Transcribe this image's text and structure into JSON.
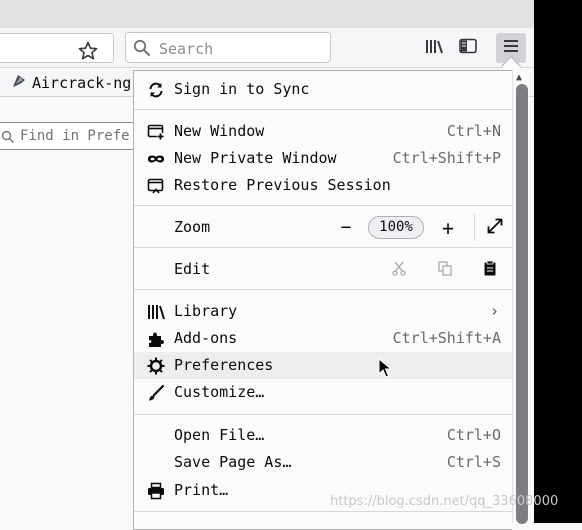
{
  "toolbar": {
    "search_placeholder": "Search"
  },
  "bookmarks": {
    "items": [
      {
        "label": "Aircrack-ng",
        "icon": "penguin-icon"
      }
    ]
  },
  "content": {
    "find_placeholder": "Find in Prefe"
  },
  "menu": {
    "sign_in": "Sign in to Sync",
    "new_window": {
      "label": "New Window",
      "shortcut": "Ctrl+N"
    },
    "new_private": {
      "label": "New Private Window",
      "shortcut": "Ctrl+Shift+P"
    },
    "restore": {
      "label": "Restore Previous Session"
    },
    "zoom": {
      "label": "Zoom",
      "minus": "−",
      "value": "100%",
      "plus": "+"
    },
    "edit": {
      "label": "Edit"
    },
    "library": {
      "label": "Library",
      "chevron": "›"
    },
    "addons": {
      "label": "Add-ons",
      "shortcut": "Ctrl+Shift+A"
    },
    "preferences": {
      "label": "Preferences"
    },
    "customize": {
      "label": "Customize…"
    },
    "open_file": {
      "label": "Open File…",
      "shortcut": "Ctrl+O"
    },
    "save_page": {
      "label": "Save Page As…",
      "shortcut": "Ctrl+S"
    },
    "print": {
      "label": "Print…"
    }
  },
  "watermark": "https://blog.csdn.net/qq_33608000",
  "colors": {
    "panel_bg": "#fbfbfc",
    "hover_bg": "#ededf0",
    "separator": "#d7d7db",
    "text": "#0c0c0d",
    "shortcut": "#6a6a70"
  }
}
